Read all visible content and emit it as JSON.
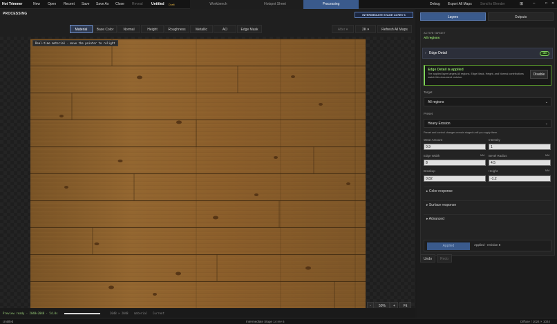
{
  "titlebar": {
    "app_name": "Hot Trimmer",
    "menu": [
      "New",
      "Open",
      "Recent",
      "Save",
      "Save As",
      "Close"
    ],
    "menu_disabled": "Reveal",
    "doc_title": "Untitled",
    "draft_label": "Draft",
    "workspace_tabs": [
      "Workbench",
      "Hotspot Sheet",
      "Processing"
    ],
    "right_menu": [
      "Debug",
      "Export All Maps"
    ],
    "right_menu_disabled": "Send to Blender",
    "window_controls": [
      "⊞",
      "–",
      "□",
      "✕"
    ]
  },
  "processing": {
    "title": "PROCESSING",
    "stage_badge": "INTERMEDIATE STAGE 14 REV 6",
    "map_tabs": [
      "Material",
      "Base Color",
      "Normal",
      "Height",
      "Roughness",
      "Metallic",
      "AO",
      "Edge Mask"
    ],
    "active_map": "Material",
    "after_label": "After",
    "resolution": "2K",
    "refresh_label": "Refresh All Maps",
    "realtime_label": "Real-time material · move the pointer to relight",
    "zoom": {
      "minus": "-",
      "level": "50%",
      "plus": "+",
      "fit": "Fit"
    },
    "status": {
      "preview": "Preview ready · 2048×2048 · 54.0s",
      "progress": 1.0,
      "size": "2048 × 2048",
      "map": "material",
      "state": "Current"
    }
  },
  "panel": {
    "tabs": [
      "Layers",
      "Outputs"
    ],
    "active_tab": "Layers",
    "active_target_label": "ACTIVE TARGET",
    "active_target_value": "All regions",
    "section_title": "Edge Detail",
    "section_toggle": "ON",
    "applied_title": "Edge Detail is applied",
    "applied_desc": "The applied layer targets All regions. Edge Mask, Height, and Normal contributions match this document revision.",
    "disable_label": "Disable",
    "target_label": "Target",
    "target_value": "All regions",
    "preset_label": "Preset",
    "preset_value": "Heavy Erosion",
    "staged_note": "Preset and control changes remain staged until you apply them.",
    "fields": [
      {
        "label": "Wear Amount",
        "unit": "",
        "value": "0.9"
      },
      {
        "label": "Intensity",
        "unit": "",
        "value": "1"
      },
      {
        "label": "Edge Width",
        "unit": "MM",
        "value": "8"
      },
      {
        "label": "Bevel Radius",
        "unit": "MM",
        "value": "4.5"
      },
      {
        "label": "Breakup",
        "unit": "",
        "value": "0.82"
      },
      {
        "label": "Height",
        "unit": "MM",
        "value": "-1.2"
      }
    ],
    "collapsibles": [
      "Color response",
      "Surface response",
      "Advanced"
    ],
    "applied_button": "Applied",
    "revision_text": "Applied · revision 8",
    "undo_label": "Undo",
    "redo_label": "Redo"
  },
  "bottombar": {
    "left": "Untitled",
    "center": "Intermediate Stage 14 rev 6",
    "right": "Diffuse / 1024 × 1024"
  },
  "colors": {
    "accent": "#3a5a8c",
    "success": "#7ed25a",
    "background": "#1b1b1b"
  }
}
